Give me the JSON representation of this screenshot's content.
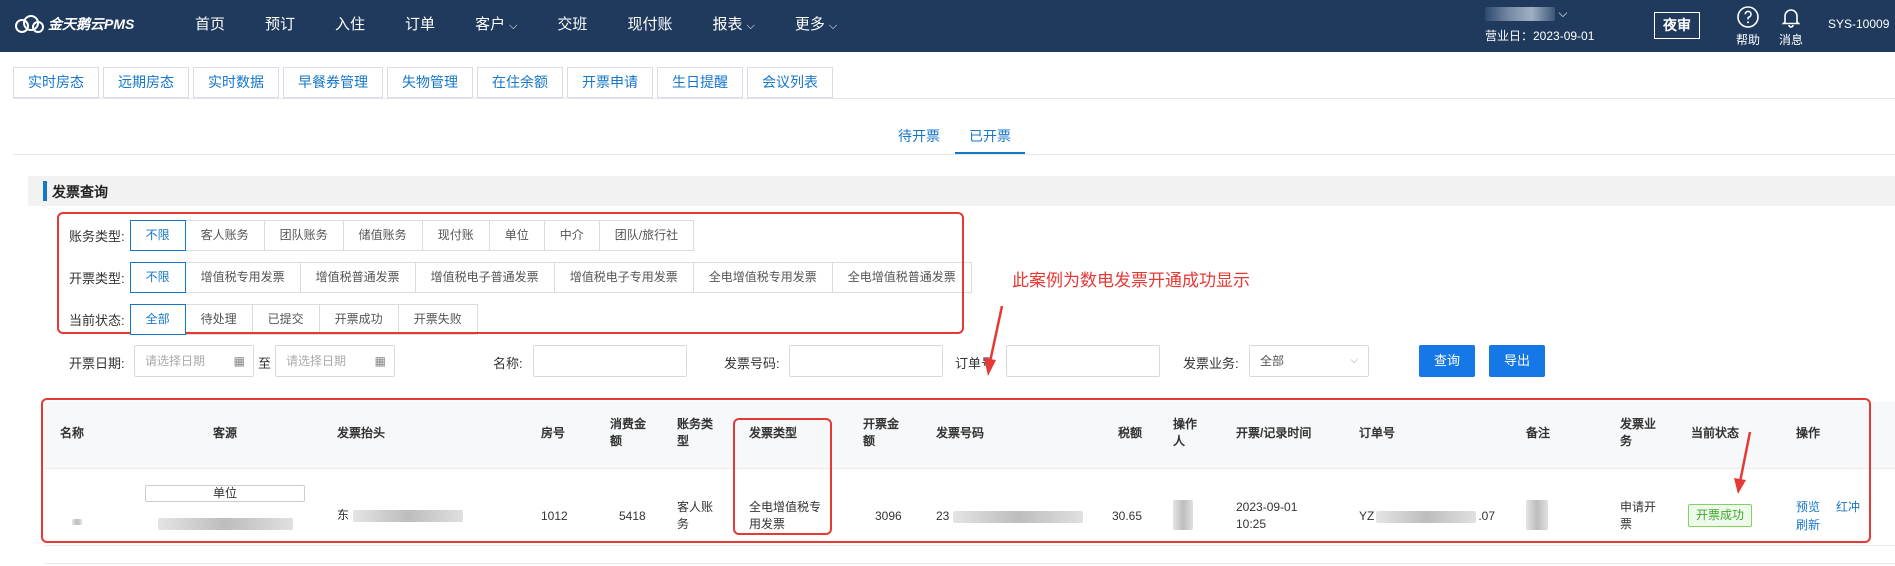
{
  "app": {
    "logo_text": "金天鹅云PMS"
  },
  "nav": {
    "items": [
      {
        "label": "首页",
        "has_caret": false
      },
      {
        "label": "预订",
        "has_caret": false
      },
      {
        "label": "入住",
        "has_caret": false
      },
      {
        "label": "订单",
        "has_caret": false
      },
      {
        "label": "客户",
        "has_caret": true
      },
      {
        "label": "交班",
        "has_caret": false
      },
      {
        "label": "现付账",
        "has_caret": false
      },
      {
        "label": "报表",
        "has_caret": true
      },
      {
        "label": "更多",
        "has_caret": true
      }
    ],
    "caret": "⌵"
  },
  "header": {
    "business_date": "营业日：2023-09-01",
    "night_audit": "夜审",
    "help": "帮助",
    "messages": "消息",
    "system_id": "SYS-10009"
  },
  "tabs": [
    "实时房态",
    "远期房态",
    "实时数据",
    "早餐券管理",
    "失物管理",
    "在住余额",
    "开票申请",
    "生日提醒",
    "会议列表"
  ],
  "subtabs": {
    "pending": "待开票",
    "issued": "已开票",
    "active": "已开票"
  },
  "section": {
    "title": "发票查询"
  },
  "filters": {
    "account_type": {
      "label": "账务类型:",
      "options": [
        "不限",
        "客人账务",
        "团队账务",
        "储值账务",
        "现付账",
        "单位",
        "中介",
        "团队/旅行社"
      ],
      "active": "不限"
    },
    "invoice_type": {
      "label": "开票类型:",
      "options": [
        "不限",
        "增值税专用发票",
        "增值税普通发票",
        "增值税电子普通发票",
        "增值税电子专用发票",
        "全电增值税专用发票",
        "全电增值税普通发票"
      ],
      "active": "不限"
    },
    "status": {
      "label": "当前状态:",
      "options": [
        "全部",
        "待处理",
        "已提交",
        "开票成功",
        "开票失败"
      ],
      "active": "全部"
    }
  },
  "annotation": {
    "text": "此案例为数电发票开通成功显示",
    "color": "#e53935"
  },
  "query": {
    "date_label": "开票日期:",
    "date_start_placeholder": "请选择日期",
    "date_sep": "至",
    "date_end_placeholder": "请选择日期",
    "name_label": "名称:",
    "invoice_no_label": "发票号码:",
    "order_no_label": "订单号",
    "business_label": "发票业务:",
    "business_value": "全部",
    "search_button": "查询",
    "export_button": "导出"
  },
  "table": {
    "headers": {
      "name": "名称",
      "source": "客源",
      "title": "发票抬头",
      "room": "房号",
      "amount_consumed": "消费金额",
      "account_type": "账务类型",
      "invoice_type": "发票类型",
      "invoice_amount": "开票金额",
      "invoice_no": "发票号码",
      "tax": "税额",
      "operator": "操作人",
      "time": "开票/记录时间",
      "order_no": "订单号",
      "remark": "备注",
      "business": "发票业务",
      "status": "当前状态",
      "actions": "操作"
    },
    "rows": [
      {
        "source_tag": "单位",
        "title_prefix": "东",
        "room": "1012",
        "amount_consumed": "5418",
        "account_type": "客人账务",
        "invoice_type": "全电增值税专用发票",
        "invoice_amount": "3096",
        "invoice_no_prefix": "23",
        "tax": "30.65",
        "time_date": "2023-09-01",
        "time_clock": "10:25",
        "order_no_prefix": "YZ",
        "order_no_suffix": ".07",
        "business": "申请开票",
        "status": "开票成功",
        "actions": [
          "预览",
          "红冲",
          "刷新"
        ]
      }
    ]
  },
  "colors": {
    "nav_bg": "#1f3a5c",
    "primary": "#1677c9",
    "annotation_red": "#e53935",
    "success_green": "#3da82a"
  }
}
